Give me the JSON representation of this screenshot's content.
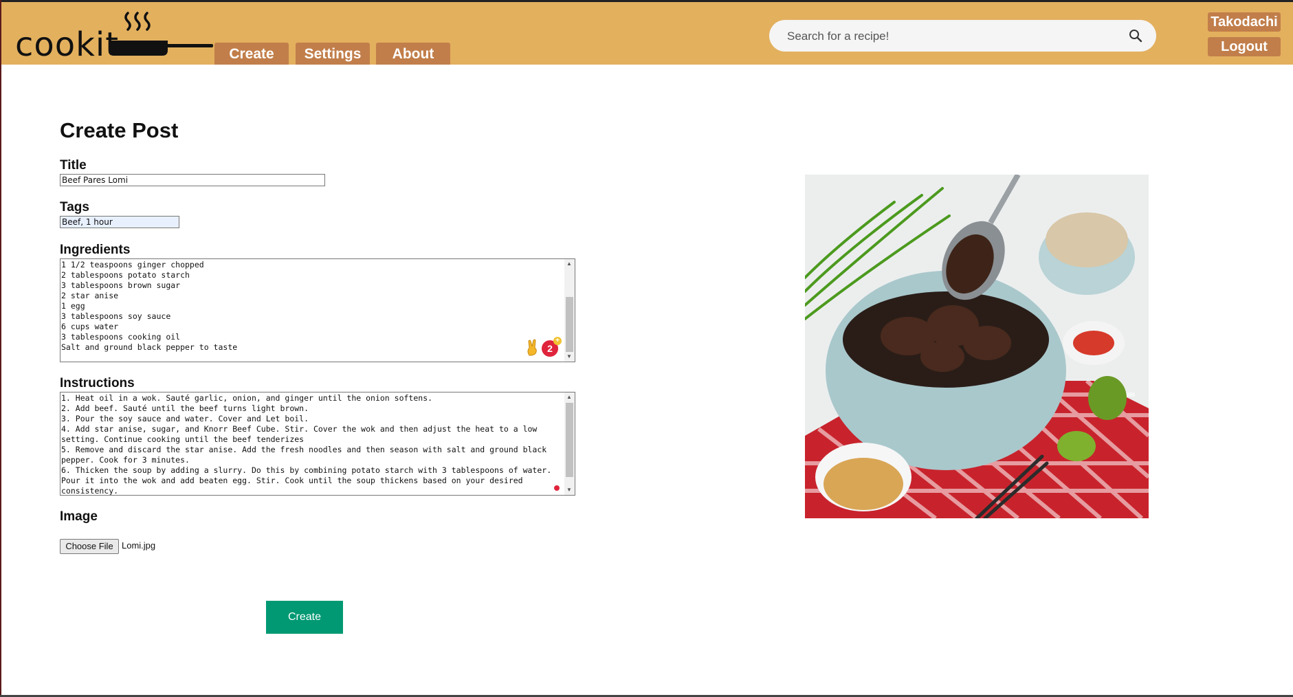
{
  "header": {
    "logo_text": "cookit",
    "nav": [
      {
        "label": "Create"
      },
      {
        "label": "Settings"
      },
      {
        "label": "About"
      }
    ],
    "search": {
      "placeholder": "Search for a recipe!",
      "value": ""
    },
    "user": {
      "name": "Takodachi",
      "logout_label": "Logout"
    }
  },
  "form": {
    "heading": "Create Post",
    "title_label": "Title",
    "title_value": "Beef Pares Lomi",
    "tags_label": "Tags",
    "tags_value": "Beef, 1 hour",
    "ingredients_label": "Ingredients",
    "ingredients_text": "1 1/2 teaspoons ginger chopped\n2 tablespoons potato starch\n3 tablespoons brown sugar\n2 star anise\n1 egg\n3 tablespoons soy sauce\n6 cups water\n3 tablespoons cooking oil\nSalt and ground black pepper to taste",
    "instructions_label": "Instructions",
    "instructions_text": "1. Heat oil in a wok. Sauté garlic, onion, and ginger until the onion softens.\n2. Add beef. Sauté until the beef turns light brown.\n3. Pour the soy sauce and water. Cover and Let boil.\n4. Add star anise, sugar, and Knorr Beef Cube. Stir. Cover the wok and then adjust the heat to a low setting. Continue cooking until the beef tenderizes\n5. Remove and discard the star anise. Add the fresh noodles and then season with salt and ground black pepper. Cook for 3 minutes.\n6. Thicken the soup by adding a slurry. Do this by combining potato starch with 3 tablespoons of water. Pour it into the wok and add beaten egg. Stir. Cook until the soup thickens based on your desired consistency.",
    "image_label": "Image",
    "file_button_label": "Choose File",
    "file_name": "Lomi.jpg",
    "grammar_count": "2",
    "submit_label": "Create"
  },
  "colors": {
    "header_bg": "#e3b05e",
    "nav_tab_bg": "#c17e4a",
    "submit_bg": "#009973"
  },
  "icons": [
    "logo-pan-icon",
    "search-icon",
    "emoji-peace-icon",
    "grammar-badge-icon"
  ]
}
